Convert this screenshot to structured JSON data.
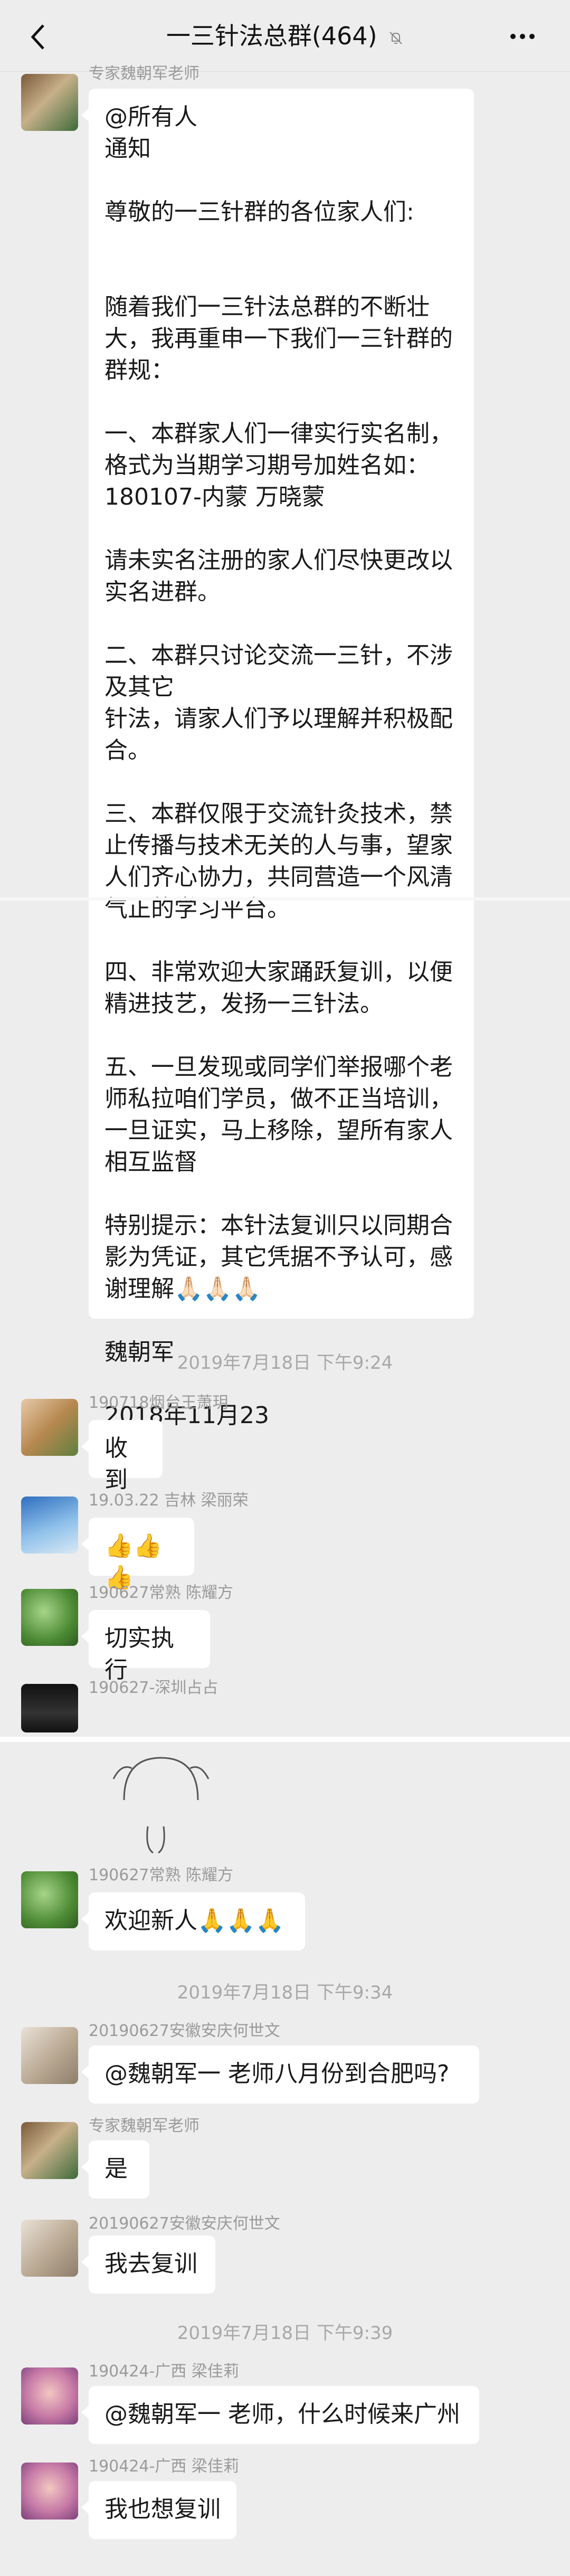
{
  "header": {
    "back_icon": "chevron-left-icon",
    "title": "一三针法总群(464)",
    "mute_icon": "bell-off-icon",
    "more_icon": "more-dots-icon"
  },
  "messages": {
    "m1": {
      "sender": "专家魏朝军老师",
      "lines": [
        "@所有人",
        "通知",
        "",
        "尊敬的一三针群的各位家人们:",
        "",
        "",
        "随着我们一三针法总群的不断壮",
        "大，我再重申一下我们一三针群的",
        "群规：",
        "",
        "一、本群家人们一律实行实名制，",
        "格式为当期学习期号加姓名如：",
        "180107-内蒙  万晓蒙",
        "",
        "请未实名注册的家人们尽快更改以",
        "实名进群。",
        "",
        "二、本群只讨论交流一三针，不涉",
        "及其它",
        "针法，请家人们予以理解并积极配",
        "合。",
        "",
        "三、本群仅限于交流针灸技术，禁",
        "止传播与技术无关的人与事，望家",
        "人们齐心协力，共同营造一个风清",
        "气正的学习平台。",
        "",
        "四、非常欢迎大家踊跃复训，以便",
        "精进技艺，发扬一三针法。",
        "",
        "五、一旦发现或同学们举报哪个老",
        "师私拉咱们学员，做不正当培训，",
        "一旦证实，马上移除，望所有家人",
        "相互监督",
        "",
        "特别提示：本针法复训只以同期合",
        "影为凭证，其它凭据不予认可，感",
        "谢理解🙏🏻🙏🏻🙏🏻",
        "",
        "        魏朝军",
        "",
        "        2018年11月23"
      ]
    },
    "ts1": "2019年7月18日 下午9:24",
    "m2": {
      "sender": "190718烟台王萧玥",
      "text": "收到"
    },
    "m3": {
      "sender": "19.03.22 吉林 梁丽荣",
      "text": "👍👍👍"
    },
    "m4": {
      "sender": "190627常熟 陈耀方",
      "text": "切实执行"
    },
    "m5": {
      "sender": "190627-深圳占占"
    },
    "m6": {
      "sender": "190627常熟 陈耀方",
      "text": "欢迎新人🙏🙏🙏"
    },
    "ts2": "2019年7月18日 下午9:34",
    "m7": {
      "sender": "20190627安徽安庆何世文",
      "text": "@魏朝军一 老师八月份到合肥吗?"
    },
    "m8": {
      "sender": "专家魏朝军老师",
      "text": "是"
    },
    "m9": {
      "sender": "20190627安徽安庆何世文",
      "text": "我去复训"
    },
    "ts3": "2019年7月18日 下午9:39",
    "m10": {
      "sender": "190424-广西 梁佳莉",
      "text": "@魏朝军一 老师，什么时候来广州"
    },
    "m11": {
      "sender": "190424-广西 梁佳莉",
      "text": "我也想复训"
    }
  }
}
